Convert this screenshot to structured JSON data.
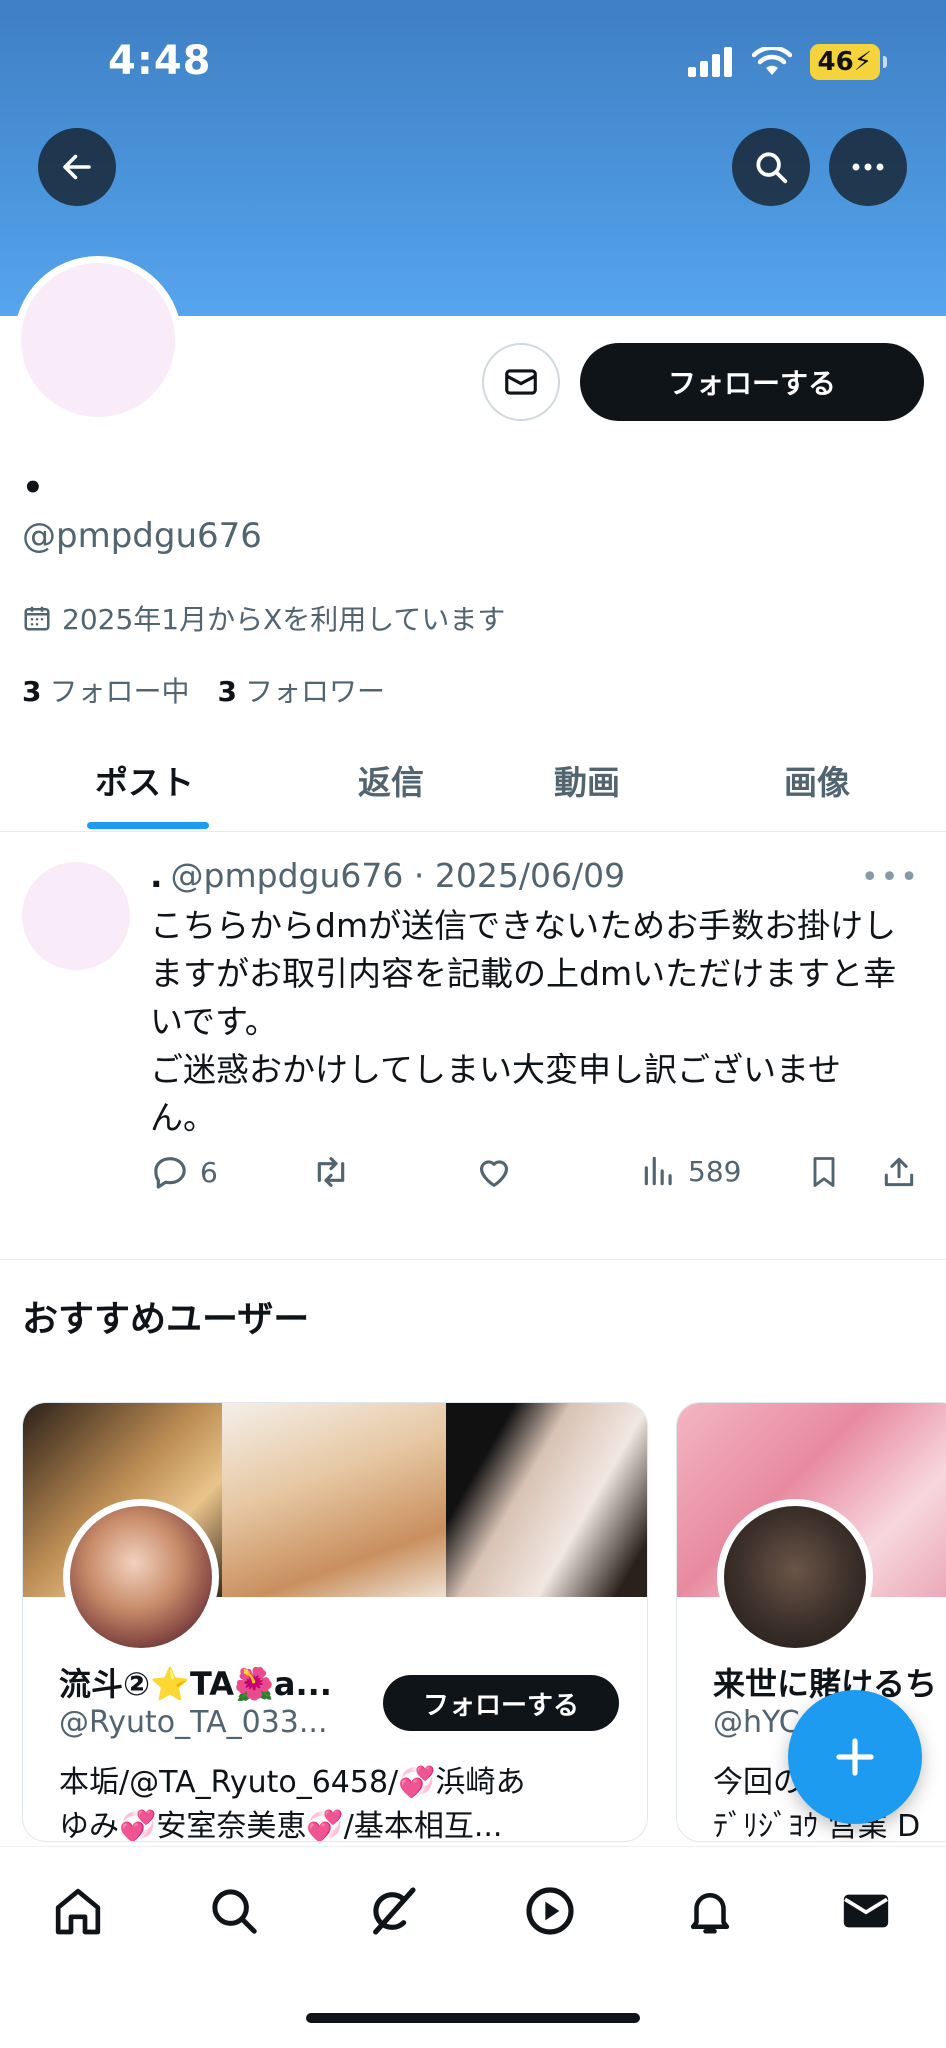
{
  "status_bar": {
    "time": "4:48",
    "battery": "46"
  },
  "profile": {
    "display_name": "•",
    "handle": "@pmpdgu676",
    "joined": "2025年1月からXを利用しています",
    "following_count": "3",
    "following_label": "フォロー中",
    "followers_count": "3",
    "followers_label": "フォロワー",
    "follow_label": "フォローする"
  },
  "tabs": [
    {
      "label": "ポスト",
      "active": true
    },
    {
      "label": "返信",
      "active": false
    },
    {
      "label": "動画",
      "active": false
    },
    {
      "label": "画像",
      "active": false
    }
  ],
  "tweet": {
    "name": ".",
    "handle": "@pmpdgu676",
    "date": "2025/06/09",
    "text_lines": [
      "こちらからdmが送信できないためお手数お掛けし",
      "ますがお取引内容を記載の上dmいただけますと幸",
      "いです。",
      "ご迷惑おかけしてしまい大変申し訳ございませ",
      "ん。"
    ],
    "replies": "6",
    "views": "589"
  },
  "recommended": {
    "title": "おすすめユーザー",
    "cards": [
      {
        "name": "流斗②⭐TA🌺a...",
        "handle": "@Ryuto_TA_033...",
        "follow_label": "フォローする",
        "bio_lines": [
          "本垢/@TA_Ryuto_6458/💞浜崎あ",
          "ゆみ💞安室奈美恵💞/基本相互..."
        ]
      },
      {
        "name": "来世に賭けるち",
        "handle": "@hYC",
        "bio_lines": [
          "今回の",
          "ﾃﾞﾘｼﾞﾖｳ 営業 D"
        ]
      }
    ]
  },
  "colors": {
    "accent": "#1d9bf0",
    "banner": "#4b95dc",
    "button": "#0f1419"
  }
}
